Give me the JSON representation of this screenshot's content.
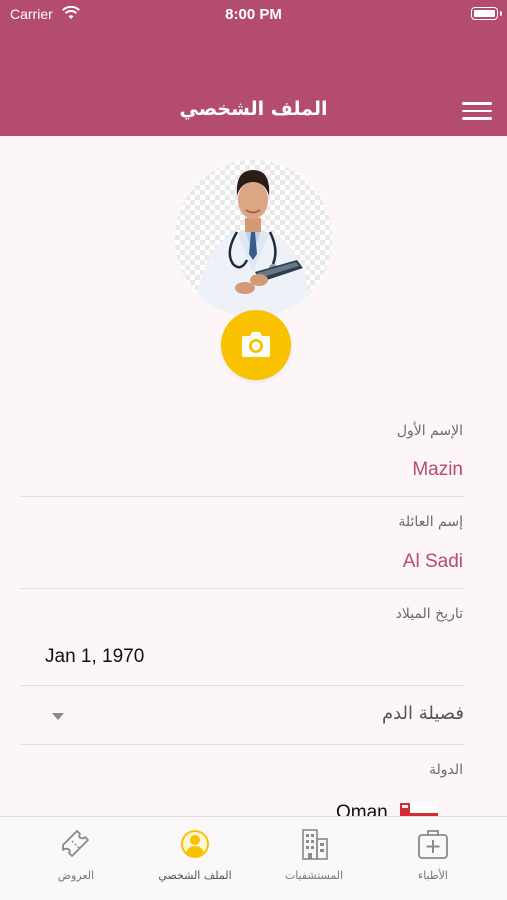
{
  "status_bar": {
    "carrier": "Carrier",
    "time": "8:00 PM"
  },
  "header": {
    "title": "الملف الشخصي"
  },
  "profile": {
    "first_name": {
      "label": "الإسم الأول",
      "value": "Mazin"
    },
    "last_name": {
      "label": "إسم العائلة",
      "value": "Al Sadi"
    },
    "birth_date": {
      "label": "تاريخ الميلاد",
      "value": "Jan 1, 1970"
    },
    "blood_type": {
      "placeholder": "فصيلة الدم"
    },
    "country": {
      "label": "الدولة",
      "value": "Oman"
    }
  },
  "tabs": [
    {
      "label": "العروض",
      "icon": "ticket-icon"
    },
    {
      "label": "الملف الشخصي",
      "icon": "profile-icon",
      "active": true
    },
    {
      "label": "المستشفيات",
      "icon": "hospital-building-icon"
    },
    {
      "label": "الأطباء",
      "icon": "medical-kit-icon"
    }
  ],
  "colors": {
    "primary": "#b44b70",
    "accent": "#f8c200",
    "background": "#fdf6f9"
  }
}
